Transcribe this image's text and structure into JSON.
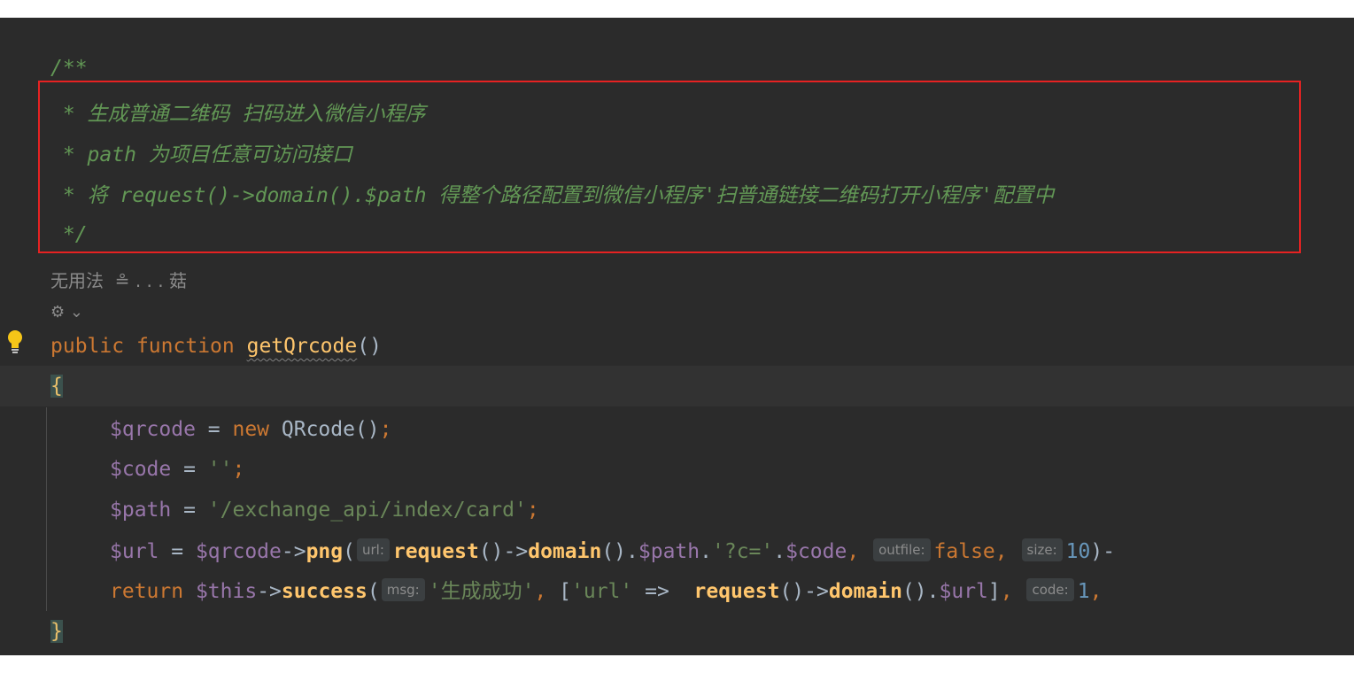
{
  "doc_comment": {
    "open": "/**",
    "line1": " * 生成普通二维码 扫码进入微信小程序",
    "line2": " * path 为项目任意可访问接口",
    "line3": " * 将 request()->domain().$path 得整个路径配置到微信小程序'扫普通链接二维码打开小程序'配置中",
    "close": " */"
  },
  "author_hint": "无用法  ≗ . . . 菇",
  "vcs_hint": "⚙ ⌄",
  "code": {
    "l_public": "public",
    "l_function": "function",
    "func_name": "getQrcode",
    "parens": "()",
    "open_brace": "{",
    "close_brace": "}",
    "qrcode_var": "$qrcode",
    "eq": " = ",
    "new_kw": "new",
    "qrcode_class": " QRcode()",
    "semicolon": ";",
    "code_var": "$code",
    "empty_str": "''",
    "path_var": "$path",
    "path_str": "'/exchange_api/index/card'",
    "url_var": "$url",
    "arrow": "->",
    "png_fn": "png",
    "open_paren": "(",
    "hint_url": "url:",
    "request_fn": "request",
    "domain_fn": "domain",
    "call_parens": "()",
    "dot": ".",
    "c_str": "'?c='",
    "comma": ",",
    "hint_outfile": "outfile:",
    "false_kw": "false",
    "hint_size": "size:",
    "size_val": "10",
    "tail1": ")-",
    "return_kw": "return",
    "this_var": "$this",
    "success_fn": "success",
    "hint_msg": "msg:",
    "msg_str": "'生成成功'",
    "arr_open": "[",
    "url_key": "'url'",
    "fat_arrow": " =>  ",
    "arr_close": "]",
    "hint_code": "code:",
    "code_val": "1",
    "tail2": ","
  }
}
